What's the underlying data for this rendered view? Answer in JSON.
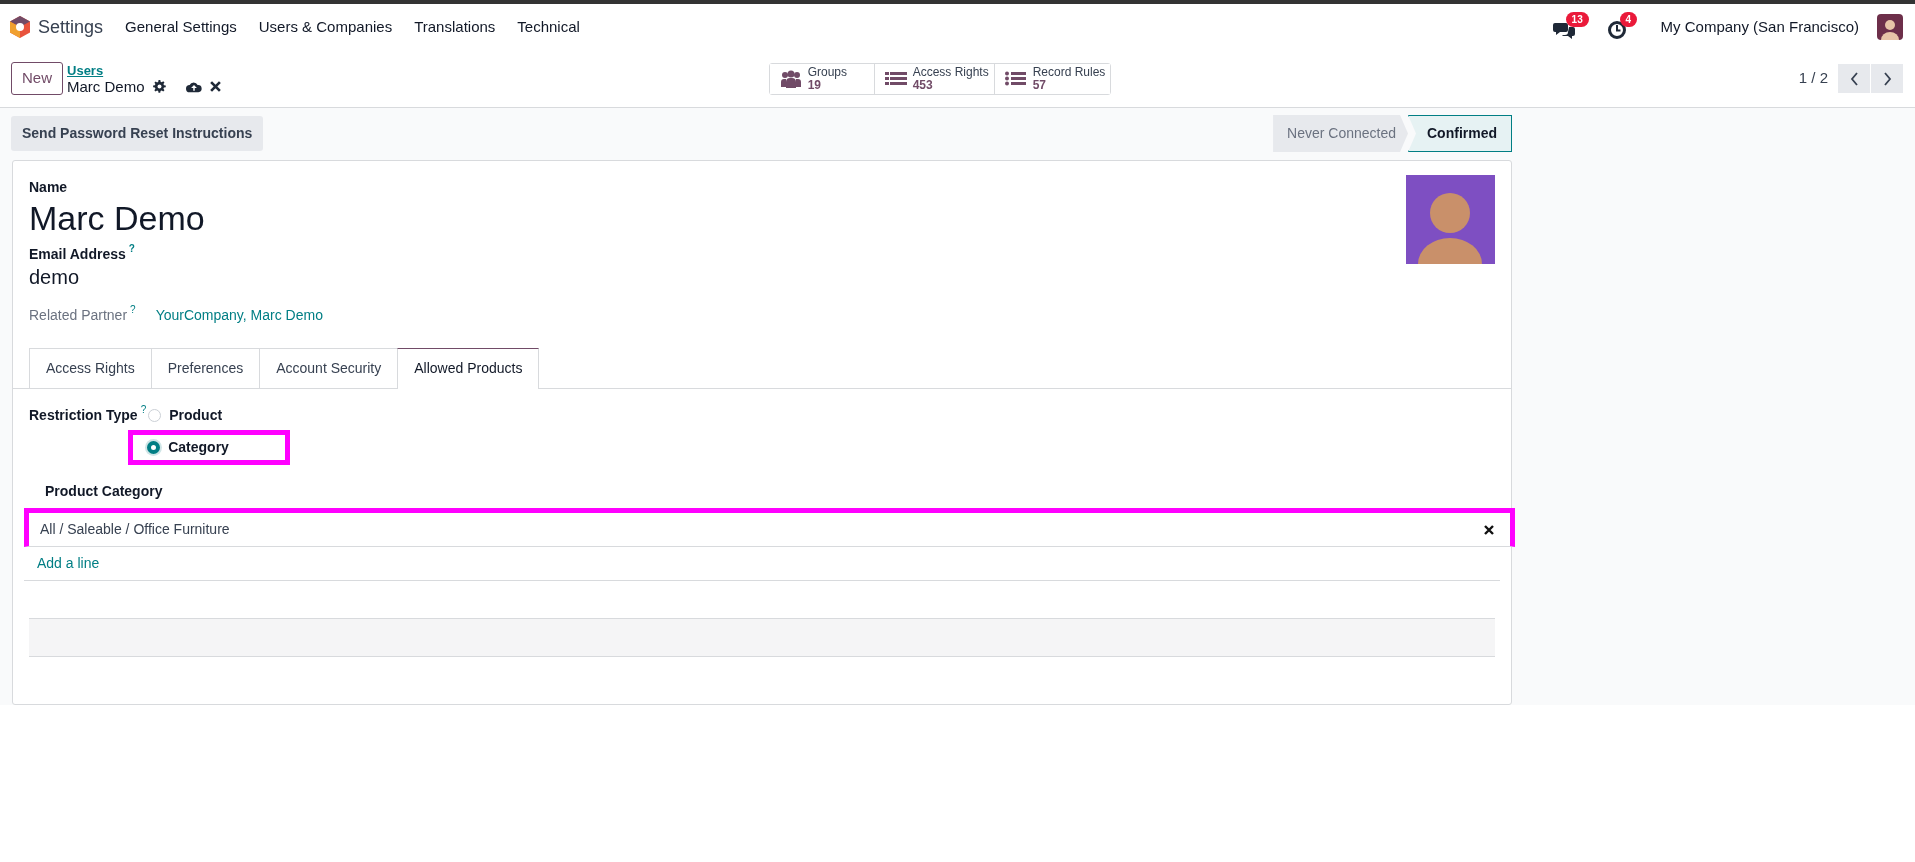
{
  "app": {
    "name": "Settings"
  },
  "menu": [
    "General Settings",
    "Users & Companies",
    "Translations",
    "Technical"
  ],
  "systray": {
    "messages_count": "13",
    "activities_count": "4",
    "company": "My Company (San Francisco)"
  },
  "control_panel": {
    "new_button": "New",
    "breadcrumb": "Users",
    "record": "Marc Demo"
  },
  "smart_buttons": [
    {
      "kind": "groups",
      "label": "Groups",
      "value": "19"
    },
    {
      "kind": "rights",
      "label": "Access Rights",
      "value": "453"
    },
    {
      "kind": "rules",
      "label": "Record Rules",
      "value": "57"
    }
  ],
  "pager": {
    "value": "1 / 2"
  },
  "action_buttons": [
    "Send Password Reset Instructions"
  ],
  "status_bar": [
    {
      "label": "Never Connected",
      "selected": false
    },
    {
      "label": "Confirmed",
      "selected": true
    }
  ],
  "form": {
    "name_label": "Name",
    "name": "Marc Demo",
    "email_label": "Email Address",
    "email_help": "?",
    "email": "demo",
    "partner_label": "Related Partner",
    "partner_help": "?",
    "partner": "YourCompany, Marc Demo"
  },
  "tabs": [
    {
      "label": "Access Rights",
      "selected": false
    },
    {
      "label": "Preferences",
      "selected": false
    },
    {
      "label": "Account Security",
      "selected": false
    },
    {
      "label": "Allowed Products",
      "selected": true
    }
  ],
  "restriction": {
    "label": "Restriction Type",
    "help": "?",
    "options": [
      {
        "label": "Product",
        "selected": false,
        "highlighted": false
      },
      {
        "label": "Category",
        "selected": true,
        "highlighted": true
      }
    ]
  },
  "category_table": {
    "columns": [
      "Product Category"
    ],
    "rows": [
      {
        "cells": [
          "All / Saleable / Office Furniture"
        ],
        "highlighted": true
      }
    ],
    "add_line": "Add a line"
  }
}
